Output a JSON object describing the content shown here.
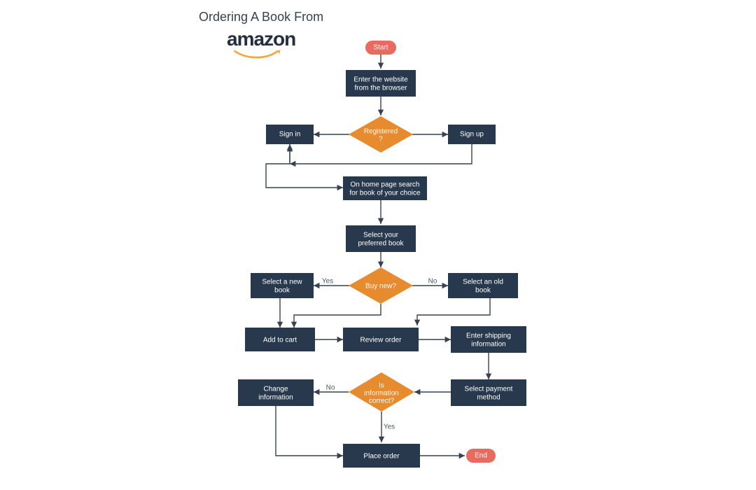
{
  "title": "Ordering A Book From",
  "brand": "amazon",
  "nodes": {
    "start": "Start",
    "enter1": "Enter the website",
    "enter2": "from the browser",
    "registered": "Registered",
    "registered_q": "?",
    "signin": "Sign in",
    "signup": "Sign up",
    "home1": "On home page search",
    "home2": "for book of your choice",
    "select1": "Select your",
    "select2": "preferred book",
    "buynew": "Buy new?",
    "newbook1": "Select a new",
    "newbook2": "book",
    "oldbook1": "Select an old",
    "oldbook2": "book",
    "addcart": "Add to cart",
    "review": "Review order",
    "ship1": "Enter shipping",
    "ship2": "information",
    "payment1": "Select payment",
    "payment2": "method",
    "info1": "Is",
    "info2": "information",
    "info3": "correct?",
    "change1": "Change",
    "change2": "information",
    "place": "Place order",
    "end": "End"
  },
  "edges": {
    "yes": "Yes",
    "no": "No"
  },
  "colors": {
    "rect": "#29394d",
    "diamond": "#e78b2f",
    "pill": "#e96a5f",
    "line": "#374151"
  }
}
